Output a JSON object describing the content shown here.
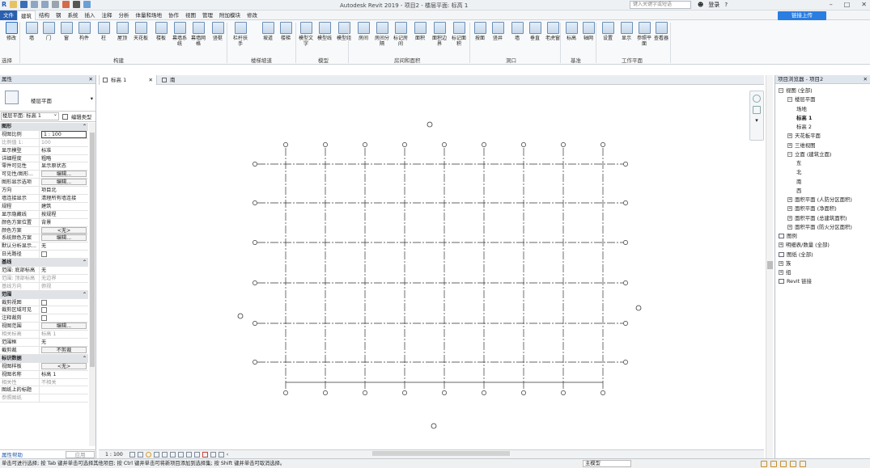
{
  "titlebar": {
    "title": "Autodesk Revit 2019 - 项目2 - 楼层平面: 标高 1",
    "search_placeholder": "键入关键字或短语",
    "login": "登录",
    "app_letter": "R"
  },
  "tabs": [
    {
      "label": "文件"
    },
    {
      "label": "建筑"
    },
    {
      "label": "结构"
    },
    {
      "label": "钢"
    },
    {
      "label": "系统"
    },
    {
      "label": "插入"
    },
    {
      "label": "注释"
    },
    {
      "label": "分析"
    },
    {
      "label": "体量和场地"
    },
    {
      "label": "协作"
    },
    {
      "label": "视图"
    },
    {
      "label": "管理"
    },
    {
      "label": "附加模块"
    },
    {
      "label": "修改"
    }
  ],
  "cloud_button": "链接上传",
  "ribbon": {
    "buttons": [
      {
        "label": "修改"
      },
      {
        "label": "墙"
      },
      {
        "label": "门"
      },
      {
        "label": "窗"
      },
      {
        "label": "构件"
      },
      {
        "label": "柱"
      },
      {
        "label": "屋顶"
      },
      {
        "label": "天花板"
      },
      {
        "label": "楼板"
      },
      {
        "label": "幕墙系统"
      },
      {
        "label": "幕墙网格"
      },
      {
        "label": "竖梃"
      },
      {
        "label": "栏杆扶手"
      },
      {
        "label": "坡道"
      },
      {
        "label": "楼梯"
      },
      {
        "label": "模型文字"
      },
      {
        "label": "模型线"
      },
      {
        "label": "模型组"
      },
      {
        "label": "房间"
      },
      {
        "label": "房间分隔"
      },
      {
        "label": "标记房间"
      },
      {
        "label": "面积"
      },
      {
        "label": "面积边界"
      },
      {
        "label": "标记面积"
      },
      {
        "label": "按面"
      },
      {
        "label": "竖井"
      },
      {
        "label": "墙"
      },
      {
        "label": "垂直"
      },
      {
        "label": "老虎窗"
      },
      {
        "label": "标高"
      },
      {
        "label": "轴网"
      },
      {
        "label": "设置"
      },
      {
        "label": "显示"
      },
      {
        "label": "参照平面"
      },
      {
        "label": "查看器"
      }
    ],
    "groups": [
      {
        "label": "选择"
      },
      {
        "label": "构建"
      },
      {
        "label": "楼梯坡道"
      },
      {
        "label": "模型"
      },
      {
        "label": "房间和面积"
      },
      {
        "label": "洞口"
      },
      {
        "label": "基准"
      },
      {
        "label": "工作平面"
      }
    ]
  },
  "properties": {
    "title": "属性",
    "type_name": "楼层平面",
    "filter": "楼层平面: 标高 1",
    "edit_type": "编辑类型",
    "rows": [
      {
        "k": "图形",
        "v": "",
        "kind": "sec"
      },
      {
        "k": "视图比例",
        "v": "1 : 100",
        "kind": "input"
      },
      {
        "k": "比例值 1:",
        "v": "100",
        "kind": "grey"
      },
      {
        "k": "显示模型",
        "v": "标准",
        "kind": "text"
      },
      {
        "k": "详细程度",
        "v": "粗略",
        "kind": "text"
      },
      {
        "k": "零件可见性",
        "v": "显示原状态",
        "kind": "text"
      },
      {
        "k": "可见性/图形...",
        "v": "编辑...",
        "kind": "btn"
      },
      {
        "k": "图形显示选项",
        "v": "编辑...",
        "kind": "btn"
      },
      {
        "k": "方向",
        "v": "项目北",
        "kind": "text"
      },
      {
        "k": "墙连接显示",
        "v": "清理所有墙连接",
        "kind": "text"
      },
      {
        "k": "规程",
        "v": "建筑",
        "kind": "text"
      },
      {
        "k": "显示隐藏线",
        "v": "按规程",
        "kind": "text"
      },
      {
        "k": "颜色方案位置",
        "v": "背景",
        "kind": "text"
      },
      {
        "k": "颜色方案",
        "v": "<无>",
        "kind": "btn"
      },
      {
        "k": "系统颜色方案",
        "v": "编辑...",
        "kind": "btn"
      },
      {
        "k": "默认分析显示...",
        "v": "无",
        "kind": "text"
      },
      {
        "k": "日光路径",
        "v": "",
        "kind": "check"
      },
      {
        "k": "基线",
        "v": "",
        "kind": "sec"
      },
      {
        "k": "范围: 底部标高",
        "v": "无",
        "kind": "text"
      },
      {
        "k": "范围: 顶部标高",
        "v": "无边界",
        "kind": "grey"
      },
      {
        "k": "基线方向",
        "v": "俯视",
        "kind": "grey"
      },
      {
        "k": "范围",
        "v": "",
        "kind": "sec"
      },
      {
        "k": "裁剪视图",
        "v": "",
        "kind": "check"
      },
      {
        "k": "裁剪区域可见",
        "v": "",
        "kind": "check"
      },
      {
        "k": "注释裁剪",
        "v": "",
        "kind": "check"
      },
      {
        "k": "视图范围",
        "v": "编辑...",
        "kind": "btn"
      },
      {
        "k": "相关标高",
        "v": "标高 1",
        "kind": "grey"
      },
      {
        "k": "范围框",
        "v": "无",
        "kind": "text"
      },
      {
        "k": "截剪裁",
        "v": "不剪裁",
        "kind": "btn"
      },
      {
        "k": "标识数据",
        "v": "",
        "kind": "sec"
      },
      {
        "k": "视图样板",
        "v": "<无>",
        "kind": "btn"
      },
      {
        "k": "视图名称",
        "v": "标高 1",
        "kind": "text"
      },
      {
        "k": "相关性",
        "v": "不相关",
        "kind": "grey"
      },
      {
        "k": "图纸上的标题",
        "v": "",
        "kind": "text"
      },
      {
        "k": "参照图纸",
        "v": "",
        "kind": "grey"
      }
    ],
    "help": "属性帮助",
    "apply": "应用"
  },
  "view_tabs": [
    {
      "label": "标高 1"
    },
    {
      "label": "南"
    }
  ],
  "view_control": {
    "scale": "1 : 100"
  },
  "grid": {
    "vertical_labels": [
      "1",
      "2",
      "3",
      "4",
      "5",
      "6",
      "7",
      "8",
      "9"
    ],
    "horizontal_labels": [
      "A",
      "B",
      "C",
      "D",
      "E",
      "F"
    ]
  },
  "browser": {
    "title": "项目浏览器 - 项目2",
    "nodes": [
      {
        "label": "视图 (全部)",
        "toggle": "−",
        "lvl": 0
      },
      {
        "label": "楼层平面",
        "toggle": "−",
        "lvl": 1
      },
      {
        "label": "场地",
        "toggle": "",
        "lvl": 2
      },
      {
        "label": "标高 1",
        "toggle": "",
        "lvl": 2,
        "bold": true
      },
      {
        "label": "标高 2",
        "toggle": "",
        "lvl": 2
      },
      {
        "label": "天花板平面",
        "toggle": "+",
        "lvl": 1
      },
      {
        "label": "三维视图",
        "toggle": "+",
        "lvl": 1
      },
      {
        "label": "立面 (建筑立面)",
        "toggle": "−",
        "lvl": 1
      },
      {
        "label": "东",
        "toggle": "",
        "lvl": 2
      },
      {
        "label": "北",
        "toggle": "",
        "lvl": 2
      },
      {
        "label": "南",
        "toggle": "",
        "lvl": 2
      },
      {
        "label": "西",
        "toggle": "",
        "lvl": 2
      },
      {
        "label": "面积平面 (人防分区面积)",
        "toggle": "+",
        "lvl": 1
      },
      {
        "label": "面积平面 (净面积)",
        "toggle": "+",
        "lvl": 1
      },
      {
        "label": "面积平面 (总建筑面积)",
        "toggle": "+",
        "lvl": 1
      },
      {
        "label": "面积平面 (防火分区面积)",
        "toggle": "+",
        "lvl": 1
      },
      {
        "label": "图例",
        "toggle": "",
        "lvl": 0
      },
      {
        "label": "明细表/数量 (全部)",
        "toggle": "+",
        "lvl": 0
      },
      {
        "label": "图纸 (全部)",
        "toggle": "",
        "lvl": 0
      },
      {
        "label": "族",
        "toggle": "+",
        "lvl": 0
      },
      {
        "label": "组",
        "toggle": "+",
        "lvl": 0
      },
      {
        "label": "Revit 链接",
        "toggle": "",
        "lvl": 0
      }
    ]
  },
  "status": {
    "message": "单击可进行选择; 按 Tab 键并单击可选择其他项目; 按 Ctrl 键并单击可将新项目添加到选择集; 按 Shift 键并单击可取消选择。",
    "model": "主模型"
  }
}
